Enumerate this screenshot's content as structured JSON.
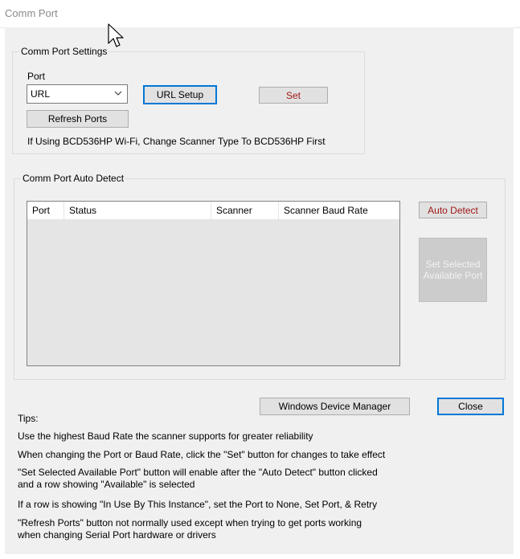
{
  "window": {
    "title": "Comm Port"
  },
  "settings": {
    "legend": "Comm Port Settings",
    "port_label": "Port",
    "port_value": "URL",
    "url_setup_label": "URL Setup",
    "set_label": "Set",
    "refresh_label": "Refresh Ports",
    "wifi_note": "If Using BCD536HP Wi-Fi, Change Scanner Type To BCD536HP First"
  },
  "auto_detect": {
    "legend": "Comm Port Auto Detect",
    "columns": [
      "Port",
      "Status",
      "Scanner",
      "Scanner Baud Rate"
    ],
    "auto_detect_label": "Auto Detect",
    "set_selected_label": "Set Selected Available Port"
  },
  "footer": {
    "device_manager_label": "Windows Device Manager",
    "close_label": "Close"
  },
  "tips": {
    "heading": "Tips:",
    "lines": [
      "Use the highest Baud Rate the scanner supports for greater reliability",
      "When changing the Port or Baud Rate, click the \"Set\" button for changes to take effect",
      "\"Set Selected Available Port\" button will enable after the \"Auto Detect\" button clicked",
      "and a row showing \"Available\" is selected",
      "If a row is showing \"In Use By This Instance\", set the Port to None, Set Port, & Retry",
      "\"Refresh Ports\" button not normally used except when trying to get ports working",
      "when changing Serial Port hardware or drivers"
    ]
  },
  "colors": {
    "accent": "#0078d7",
    "warning_text": "#a01818",
    "dialog_bg": "#f0f0f0"
  }
}
